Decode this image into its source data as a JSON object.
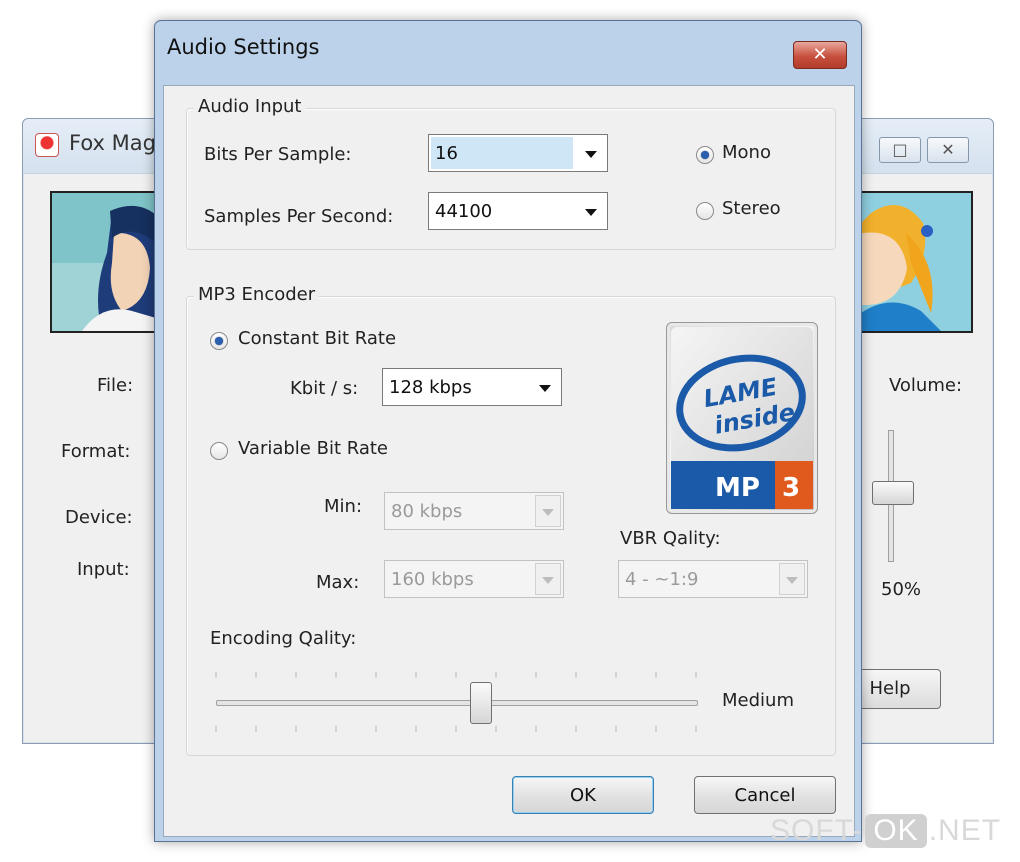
{
  "background_window": {
    "title": "Fox Mag",
    "controls": {
      "restore": "□",
      "close": "✕"
    },
    "labels": {
      "file": "File:",
      "format": "Format:",
      "device": "Device:",
      "input": "Input:",
      "volume": "Volume:"
    },
    "volume_value": "50%",
    "volume_level": 0.5,
    "help_button": "Help"
  },
  "dialog": {
    "title": "Audio Settings",
    "close_label": "✕",
    "audio_input": {
      "group_label": "Audio Input",
      "bits_label": "Bits Per Sample:",
      "bits_value": "16",
      "samples_label": "Samples Per Second:",
      "samples_value": "44100",
      "mono_label": "Mono",
      "stereo_label": "Stereo",
      "selected_channel": "Mono"
    },
    "mp3_encoder": {
      "group_label": "MP3 Encoder",
      "cbr_label": "Constant Bit Rate",
      "kbit_label": "Kbit / s:",
      "kbit_value": "128 kbps",
      "vbr_label": "Variable Bit Rate",
      "min_label": "Min:",
      "min_value": "80 kbps",
      "max_label": "Max:",
      "max_value": "160 kbps",
      "vbr_quality_label": "VBR Qality:",
      "vbr_quality_value": "4 - ~1:9",
      "encoding_quality_label": "Encoding Qality:",
      "encoding_quality_value": "Medium",
      "selected_mode": "Constant Bit Rate",
      "logo": {
        "line1": "LAME",
        "line2": "inside",
        "badge": "MP",
        "badge_num": "3"
      }
    },
    "buttons": {
      "ok": "OK",
      "cancel": "Cancel"
    }
  },
  "watermark": {
    "pre": "SOFT-",
    "box": "OK",
    "post": ".NET"
  },
  "colors": {
    "title_bar": "#bcd2ea",
    "close_red": "#c7503e",
    "radio_dot": "#2a5fb0",
    "lame_blue": "#1a5aa8",
    "mp3_orange": "#e05a1e"
  }
}
